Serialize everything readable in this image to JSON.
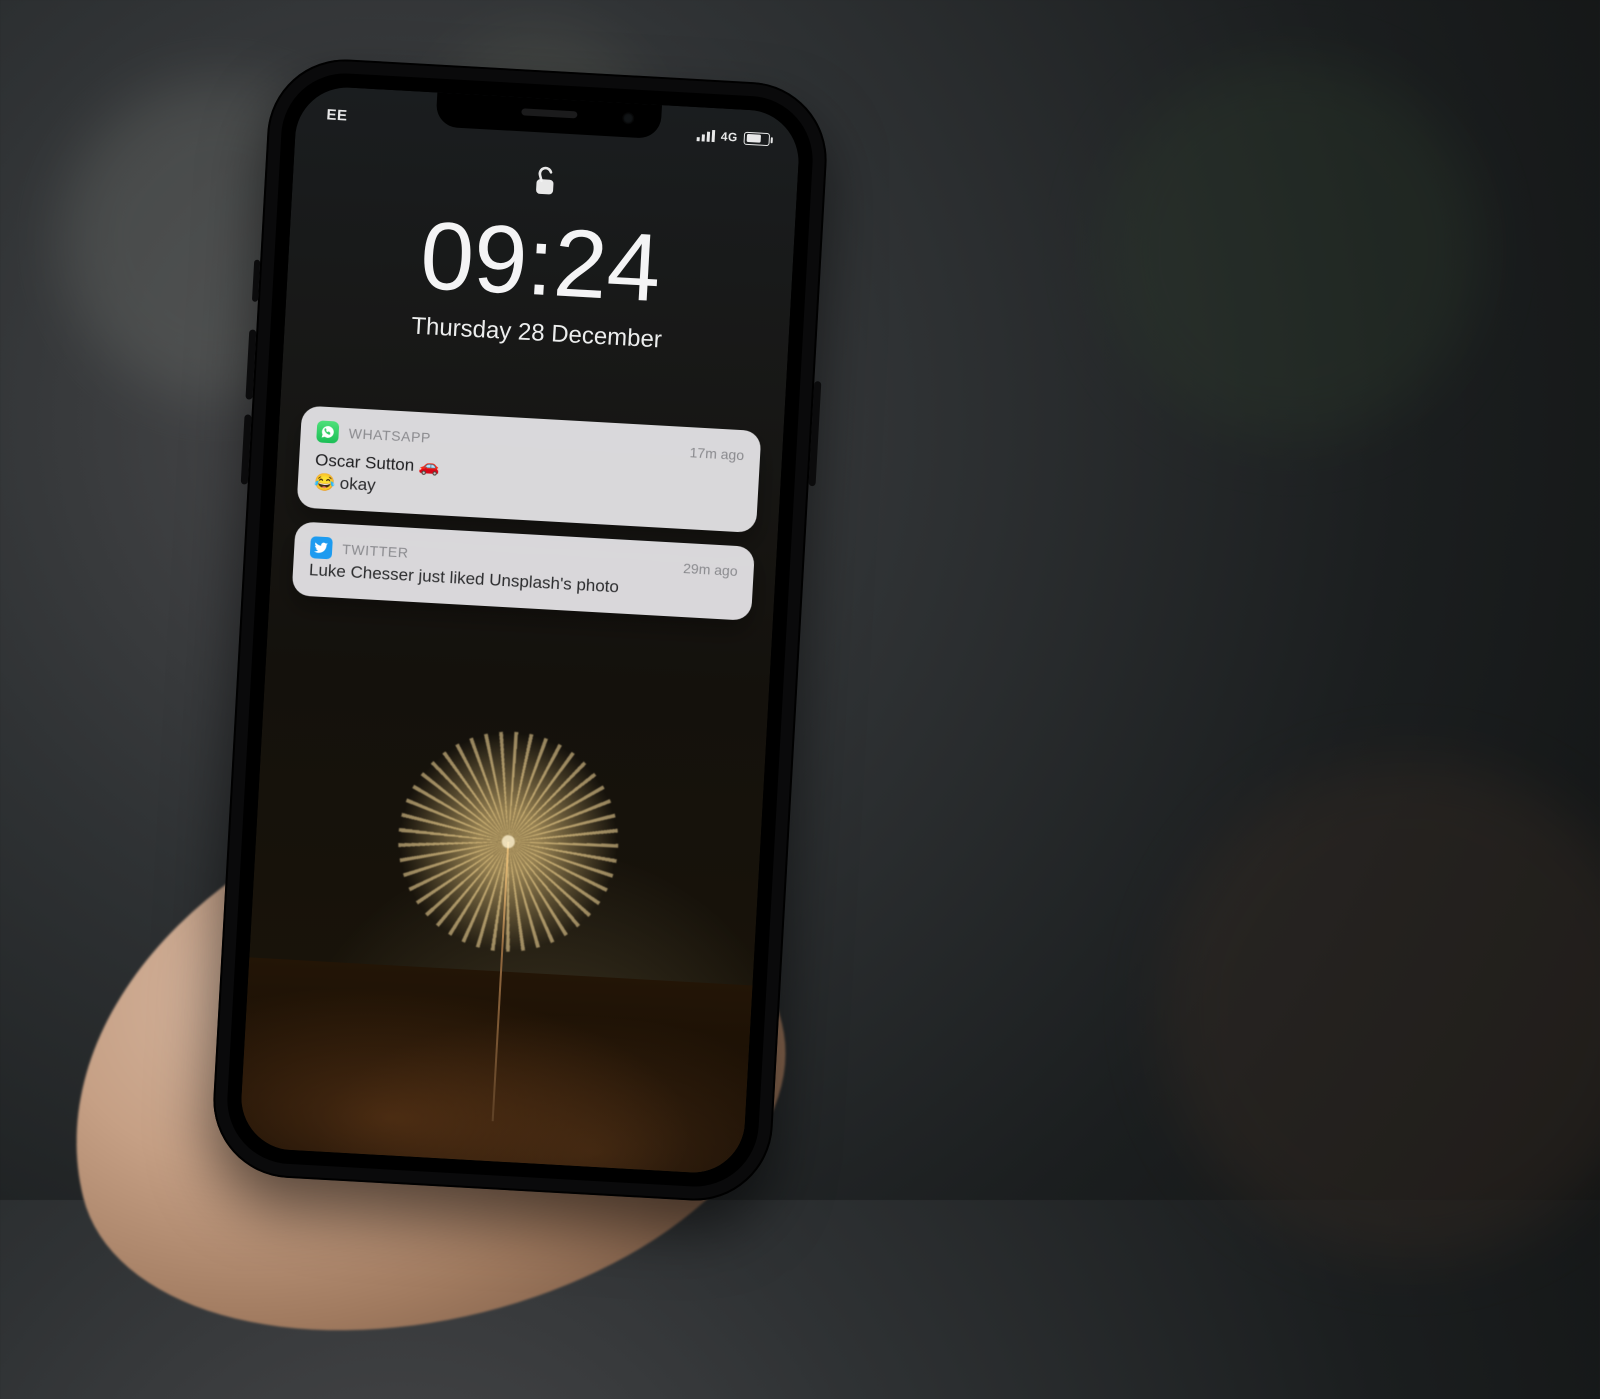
{
  "statusbar": {
    "carrier": "EE",
    "network_label": "4G"
  },
  "lockscreen": {
    "time": "09:24",
    "date": "Thursday 28 December"
  },
  "notifications": [
    {
      "app_name": "WHATSAPP",
      "icon": "whatsapp-icon",
      "time": "17m ago",
      "title": "Oscar Sutton 🚗",
      "body": "😂 okay"
    },
    {
      "app_name": "TWITTER",
      "icon": "twitter-icon",
      "time": "29m ago",
      "body": "Luke Chesser just liked Unsplash's photo"
    }
  ]
}
